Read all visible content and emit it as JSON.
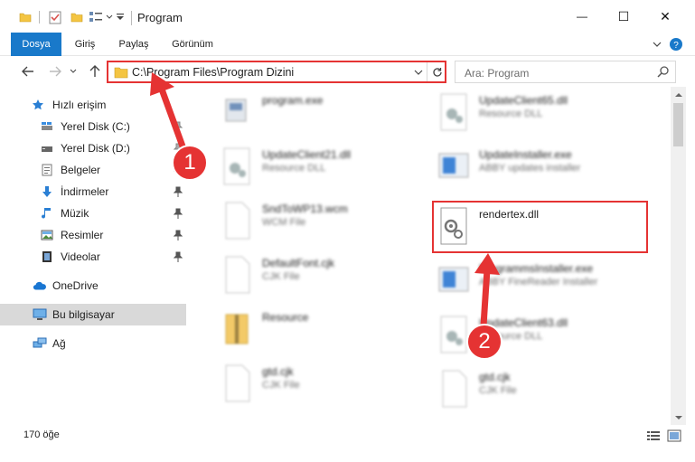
{
  "window": {
    "title": "Program",
    "minimize_glyph": "—",
    "maximize_glyph": "☐",
    "close_glyph": "✕"
  },
  "ribbon": {
    "tabs": [
      {
        "label": "Dosya"
      },
      {
        "label": "Giriş"
      },
      {
        "label": "Paylaş"
      },
      {
        "label": "Görünüm"
      }
    ]
  },
  "address": {
    "path": "C:\\Program Files\\Program Dizini"
  },
  "search": {
    "placeholder": "Ara: Program"
  },
  "sidebar": {
    "items": [
      {
        "label": "Hızlı erişim",
        "icon": "star-icon"
      },
      {
        "label": "Yerel Disk (C:)",
        "icon": "drive-icon"
      },
      {
        "label": "Yerel Disk (D:)",
        "icon": "drive-icon"
      },
      {
        "label": "Belgeler",
        "icon": "documents-icon"
      },
      {
        "label": "İndirmeler",
        "icon": "download-icon"
      },
      {
        "label": "Müzik",
        "icon": "music-icon"
      },
      {
        "label": "Resimler",
        "icon": "pictures-icon"
      },
      {
        "label": "Videolar",
        "icon": "video-icon"
      },
      {
        "label": "OneDrive",
        "icon": "cloud-icon"
      },
      {
        "label": "Bu bilgisayar",
        "icon": "computer-icon"
      },
      {
        "label": "Ağ",
        "icon": "network-icon"
      }
    ]
  },
  "files": [
    {
      "name": "program.exe",
      "type": "",
      "icon": "program-exe-icon"
    },
    {
      "name": "UpdateClient65.dll",
      "type": "Resource DLL",
      "icon": "dll-gear-icon"
    },
    {
      "name": "UpdateClient21.dll",
      "type": "Resource DLL",
      "icon": "dll-gear-icon"
    },
    {
      "name": "UpdateInstaller.exe",
      "type": "ABBY updates installer",
      "icon": "installer-icon"
    },
    {
      "name": "SndToWP13.wcm",
      "type": "WCM File",
      "icon": "blank-file-icon"
    },
    {
      "name": "rendertex.dll",
      "type": "",
      "icon": "dll-gear-icon"
    },
    {
      "name": "DefaultFont.cjk",
      "type": "CJK File",
      "icon": "blank-file-icon"
    },
    {
      "name": "ProgrammsInstaller.exe",
      "type": "ABBY FineReader Installer",
      "icon": "installer-icon"
    },
    {
      "name": "Resource",
      "type": "",
      "icon": "folder-zip-icon"
    },
    {
      "name": "UpdateClient63.dll",
      "type": "Resource DLL",
      "icon": "dll-gear-icon"
    },
    {
      "name": "gtd.cjk",
      "type": "CJK File",
      "icon": "blank-file-icon"
    },
    {
      "name": "gtd.cjk",
      "type": "CJK File",
      "icon": "blank-file-icon"
    }
  ],
  "status": {
    "count": "170 öğe"
  },
  "annotations": {
    "badge1": "1",
    "badge2": "2"
  },
  "colors": {
    "accent": "#1979ca",
    "annotation": "#e53333"
  }
}
